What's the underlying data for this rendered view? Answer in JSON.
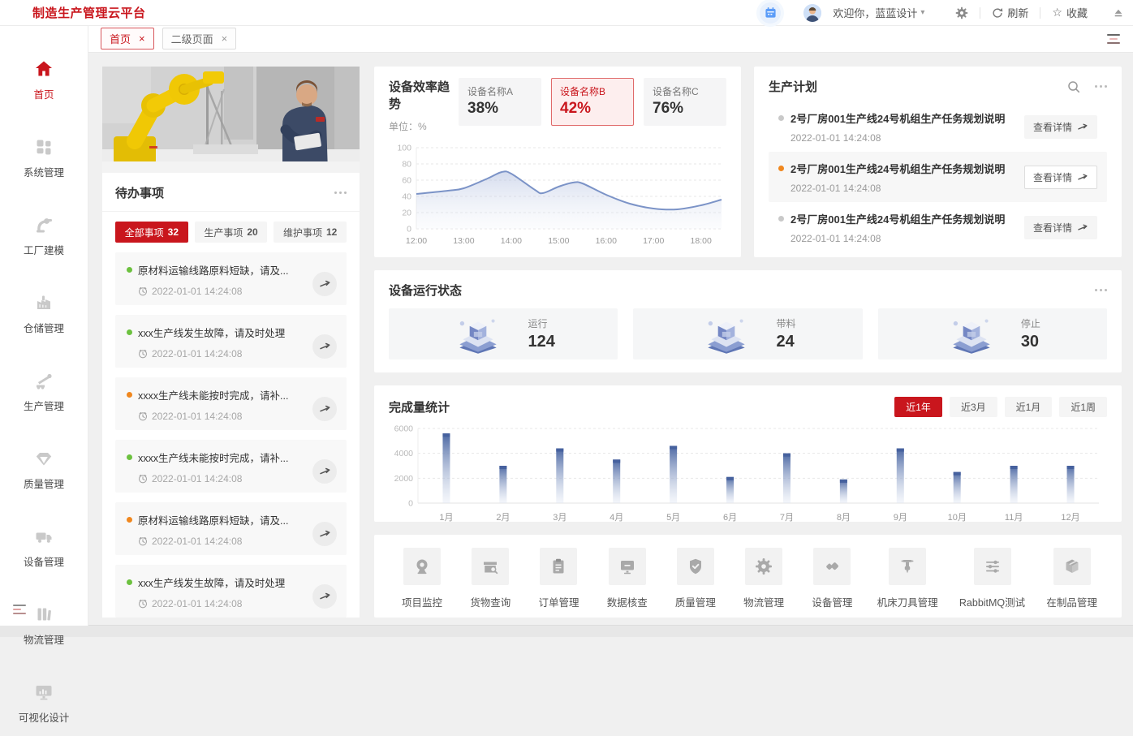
{
  "app": {
    "title": "制造生产管理云平台"
  },
  "colors": {
    "accent": "#c9161d",
    "green_dot": "#6cc13f",
    "orange_dot": "#f0871e",
    "line_blue": "#7b93c7",
    "bar_blue": "#4a66a2",
    "calendar_blue": "#4f8ef7"
  },
  "header": {
    "welcome": "欢迎你，蓝蓝设计",
    "refresh_label": "刷新",
    "favorite_label": "收藏"
  },
  "tabs": [
    {
      "label": "首页",
      "state": "active"
    },
    {
      "label": "二级页面",
      "state": ""
    }
  ],
  "sidebar": {
    "items": [
      {
        "label": "首页"
      },
      {
        "label": "系统管理"
      },
      {
        "label": "工厂建模"
      },
      {
        "label": "仓储管理"
      },
      {
        "label": "生产管理"
      },
      {
        "label": "质量管理"
      },
      {
        "label": "设备管理"
      },
      {
        "label": "物流管理"
      },
      {
        "label": "可视化设计"
      }
    ]
  },
  "todo": {
    "panel_title": "待办事项",
    "filters": [
      {
        "label": "全部事项",
        "count": "32",
        "state": "active"
      },
      {
        "label": "生产事项",
        "count": "20",
        "state": ""
      },
      {
        "label": "维护事项",
        "count": "12",
        "state": ""
      }
    ],
    "items": [
      {
        "dot": "green",
        "title": "原材料运输线路原料短缺，请及...",
        "time": "2022-01-01 14:24:08"
      },
      {
        "dot": "green",
        "title": "xxx生产线发生故障，请及时处理",
        "time": "2022-01-01 14:24:08"
      },
      {
        "dot": "orange",
        "title": "xxxx生产线未能按时完成，请补...",
        "time": "2022-01-01 14:24:08"
      },
      {
        "dot": "green",
        "title": "xxxx生产线未能按时完成，请补...",
        "time": "2022-01-01 14:24:08"
      },
      {
        "dot": "orange",
        "title": "原材料运输线路原料短缺，请及...",
        "time": "2022-01-01 14:24:08"
      },
      {
        "dot": "green",
        "title": "xxx生产线发生故障，请及时处理",
        "time": "2022-01-01 14:24:08"
      }
    ]
  },
  "efficiency": {
    "panel_title": "设备效率趋势",
    "unit_label": "单位：%",
    "devices": [
      {
        "name": "设备名称A",
        "value": "38%",
        "state": ""
      },
      {
        "name": "设备名称B",
        "value": "42%",
        "state": "active"
      },
      {
        "name": "设备名称C",
        "value": "76%",
        "state": ""
      }
    ]
  },
  "plans": {
    "panel_title": "生产计划",
    "items": [
      {
        "dot": "grey",
        "title": "2号厂房001生产线24号机组生产任务规划说明",
        "time": "2022-01-01 14:24:08",
        "button": "查看详情",
        "state": ""
      },
      {
        "dot": "orange",
        "title": "2号厂房001生产线24号机组生产任务规划说明",
        "time": "2022-01-01 14:24:08",
        "button": "查看详情",
        "state": "highlight"
      },
      {
        "dot": "grey",
        "title": "2号厂房001生产线24号机组生产任务规划说明",
        "time": "2022-01-01 14:24:08",
        "button": "查看详情",
        "state": ""
      }
    ]
  },
  "status": {
    "panel_title": "设备运行状态",
    "cards": [
      {
        "label": "运行",
        "value": "124"
      },
      {
        "label": "带料",
        "value": "24"
      },
      {
        "label": "停止",
        "value": "30"
      }
    ]
  },
  "completion": {
    "panel_title": "完成量统计",
    "ranges": [
      {
        "label": "近1年",
        "state": "active"
      },
      {
        "label": "近3月",
        "state": ""
      },
      {
        "label": "近1月",
        "state": ""
      },
      {
        "label": "近1周",
        "state": ""
      }
    ]
  },
  "links": {
    "items": [
      {
        "label": "项目监控"
      },
      {
        "label": "货物查询"
      },
      {
        "label": "订单管理"
      },
      {
        "label": "数据核查"
      },
      {
        "label": "质量管理"
      },
      {
        "label": "物流管理"
      },
      {
        "label": "设备管理"
      },
      {
        "label": "机床刀具管理"
      },
      {
        "label": "RabbitMQ测试"
      },
      {
        "label": "在制品管理"
      }
    ]
  },
  "chart_data": [
    {
      "type": "line",
      "title": "设备效率趋势",
      "ylabel": "单位：%",
      "x_ticks": [
        "12:00",
        "13:00",
        "14:00",
        "15:00",
        "16:00",
        "17:00",
        "18:00"
      ],
      "x_minutes": [
        0,
        40,
        60,
        90,
        108,
        120,
        150,
        160,
        180,
        198,
        210,
        240,
        270,
        300,
        330,
        360,
        386
      ],
      "y": [
        43,
        47,
        50,
        62,
        70,
        68,
        48,
        44,
        52,
        57,
        56,
        42,
        31,
        25,
        24,
        29,
        36
      ],
      "ylim": [
        0,
        100
      ],
      "y_ticks": [
        0,
        20,
        40,
        60,
        80,
        100
      ],
      "grid": "dashed-horizontal",
      "legend": "none"
    },
    {
      "type": "bar",
      "title": "完成量统计",
      "categories": [
        "1月",
        "2月",
        "3月",
        "4月",
        "5月",
        "6月",
        "7月",
        "8月",
        "9月",
        "10月",
        "11月",
        "12月"
      ],
      "values": [
        5600,
        3000,
        4400,
        3500,
        4600,
        2100,
        4000,
        1900,
        4400,
        2500,
        3000,
        3000
      ],
      "ylim": [
        0,
        6000
      ],
      "y_ticks": [
        0,
        2000,
        4000,
        6000
      ],
      "grid": "dashed-horizontal",
      "legend": "none"
    }
  ]
}
